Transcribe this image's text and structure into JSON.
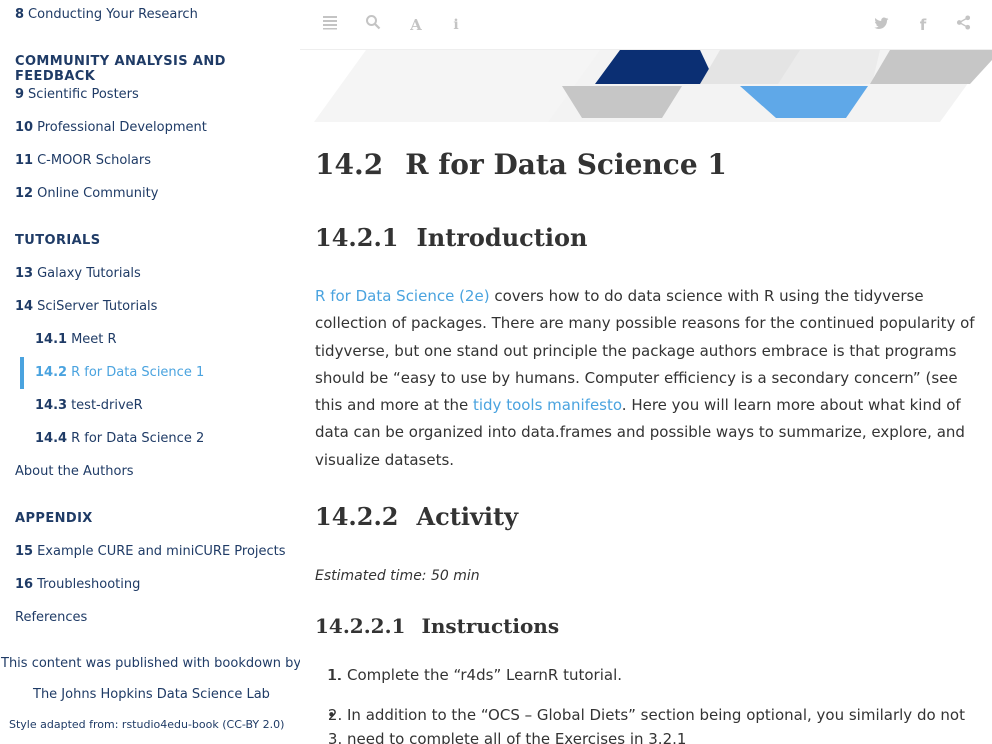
{
  "sidebar": {
    "top_item": {
      "num": "8",
      "label": "Conducting Your Research"
    },
    "sections": {
      "community": "COMMUNITY ANALYSIS AND FEEDBACK",
      "tutorials": "TUTORIALS",
      "appendix": "APPENDIX"
    },
    "community_items": [
      {
        "num": "9",
        "label": "Scientific Posters"
      },
      {
        "num": "10",
        "label": "Professional Development"
      },
      {
        "num": "11",
        "label": "C-MOOR Scholars"
      },
      {
        "num": "12",
        "label": "Online Community"
      }
    ],
    "tutorial_items": [
      {
        "num": "13",
        "label": "Galaxy Tutorials"
      },
      {
        "num": "14",
        "label": "SciServer Tutorials"
      }
    ],
    "sub_items": [
      {
        "num": "14.1",
        "label": "Meet R"
      },
      {
        "num": "14.2",
        "label": "R for Data Science 1"
      },
      {
        "num": "14.3",
        "label": "test-driveR"
      },
      {
        "num": "14.4",
        "label": "R for Data Science 2"
      }
    ],
    "about": "About the Authors",
    "appendix_items": [
      {
        "num": "15",
        "label": "Example CURE and miniCURE Projects"
      },
      {
        "num": "16",
        "label": "Troubleshooting"
      }
    ],
    "references": "References",
    "published_with": "This content was published with bookdown by:",
    "lab": "The Johns Hopkins Data Science Lab",
    "style_credit": "Style adapted from: rstudio4edu-book (CC-BY 2.0)"
  },
  "toolbar": {
    "icons": [
      "sidebar-toggle-icon",
      "search-icon",
      "font-settings-icon",
      "info-icon",
      "twitter-icon",
      "facebook-icon",
      "share-icon"
    ]
  },
  "colors": {
    "navy": "#1f3b66",
    "accent": "#4aa3df",
    "banner_dark": "#0b2f73",
    "banner_light": "#5fa8e8"
  },
  "content": {
    "h_main": {
      "num": "14.2",
      "title": "R for Data Science 1"
    },
    "h_intro": {
      "num": "14.2.1",
      "title": "Introduction"
    },
    "intro": {
      "link1": "R for Data Science (2e)",
      "text1": " covers how to do data science with R using the tidyverse collection of packages. There are many possible reasons for the continued popularity of tidyverse, but one stand out principle the package authors embrace is that programs should be “easy to use by humans. Computer efficiency is a secondary concern” (see this and more at the ",
      "link2": "tidy tools manifesto",
      "text2": ". Here you will learn more about what kind of data can be organized into data.frames and possible ways to summarize, explore, and visualize datasets."
    },
    "h_activity": {
      "num": "14.2.2",
      "title": "Activity"
    },
    "estimated_time": "Estimated time: 50 min",
    "h_instructions": {
      "num": "14.2.2.1",
      "title": "Instructions"
    },
    "steps": [
      {
        "marker": "1.",
        "text": "Complete the “r4ds” LearnR tutorial."
      },
      {
        "marker": "•",
        "text": "In addition to the “OCS – Global Diets” section being optional, you similarly do not"
      },
      {
        "marker": "",
        "text": "need to complete all of the Exercises in 3.2.1"
      }
    ]
  }
}
